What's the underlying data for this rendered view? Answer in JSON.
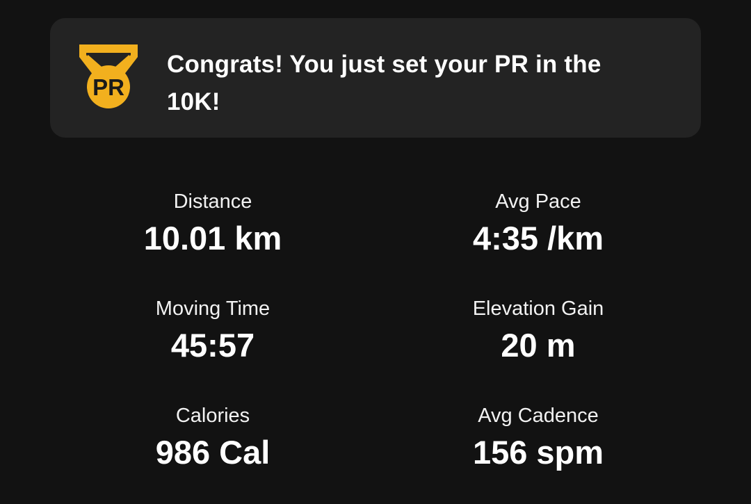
{
  "banner": {
    "message": "Congrats! You just set your PR in the 10K!",
    "badge_text": "PR",
    "badge_color": "#F2B01E",
    "badge_text_color": "#1a1a1a"
  },
  "stats": [
    {
      "label": "Distance",
      "value": "10.01 km"
    },
    {
      "label": "Avg Pace",
      "value": "4:35 /km"
    },
    {
      "label": "Moving Time",
      "value": "45:57"
    },
    {
      "label": "Elevation Gain",
      "value": "20 m"
    },
    {
      "label": "Calories",
      "value": "986 Cal"
    },
    {
      "label": "Avg Cadence",
      "value": "156 spm"
    }
  ],
  "colors": {
    "background": "#121212",
    "card": "#232323",
    "text": "#FFFFFF"
  }
}
